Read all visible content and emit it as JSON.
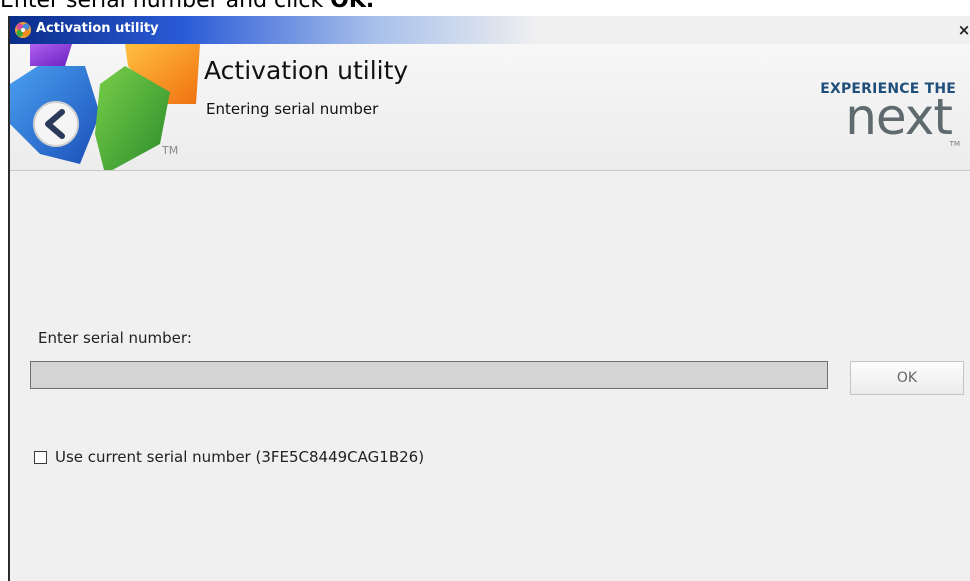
{
  "instruction": {
    "prefix": "Enter serial number and click ",
    "emphasis": "OK."
  },
  "window": {
    "title": "Activation utility",
    "close_label": "×"
  },
  "header": {
    "title": "Activation utility",
    "subtitle": "Entering serial number",
    "logo_tm": "TM",
    "brand_tagline": "EXPERIENCE THE",
    "brand_wordmark": "next",
    "brand_tm": "TM"
  },
  "form": {
    "serial_label": "Enter serial number:",
    "serial_value": "",
    "ok_label": "OK",
    "use_current_label": "Use current serial number (3FE5C8449CAG1B26)",
    "use_current_checked": false
  },
  "colors": {
    "titlebar_start": "#0a2d8a",
    "brand_blue": "#1f4f7a",
    "brand_gray": "#5f6a6e",
    "logo_blue": "#2a6fd6",
    "logo_green": "#3aa83a",
    "logo_orange": "#f08a1a",
    "logo_purple": "#8a3ad0"
  }
}
